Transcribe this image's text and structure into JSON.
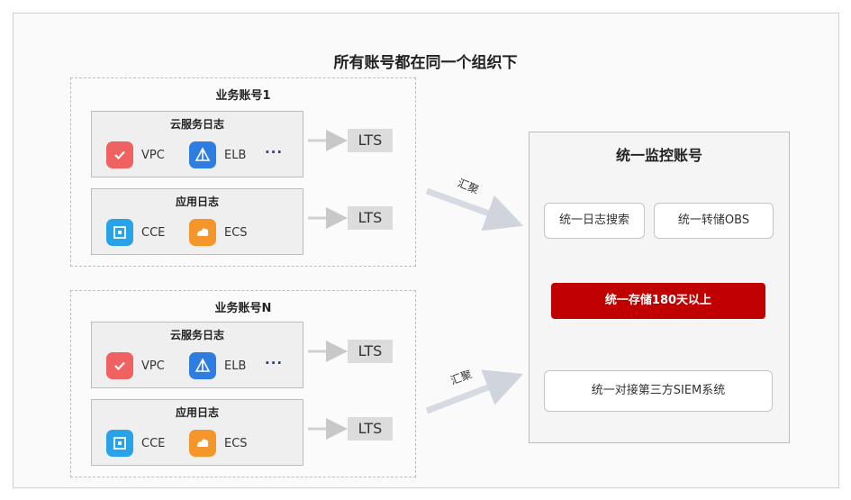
{
  "title": "所有账号都在同一个组织下",
  "accounts": [
    {
      "title": "业务账号1",
      "cloud_group": {
        "title": "云服务日志",
        "services": [
          "VPC",
          "ELB"
        ],
        "more": "···"
      },
      "app_group": {
        "title": "应用日志",
        "services": [
          "CCE",
          "ECS"
        ]
      },
      "lts": [
        "LTS",
        "LTS"
      ]
    },
    {
      "title": "业务账号N",
      "cloud_group": {
        "title": "云服务日志",
        "services": [
          "VPC",
          "ELB"
        ],
        "more": "···"
      },
      "app_group": {
        "title": "应用日志",
        "services": [
          "CCE",
          "ECS"
        ]
      },
      "lts": [
        "LTS",
        "LTS"
      ]
    }
  ],
  "aggregate_label": "汇聚",
  "monitor": {
    "title": "统一监控账号",
    "search": "统一日志搜索",
    "obs": "统一转储OBS",
    "storage": "统一存储180天以上",
    "siem": "统一对接第三方SIEM系统"
  },
  "colors": {
    "vpc": "#f06262",
    "elb": "#2f7de1",
    "cce": "#29a3e8",
    "ecs": "#f5962a",
    "red": "#c00000"
  },
  "icons": {
    "vpc": "vpc-icon",
    "elb": "elb-icon",
    "cce": "cce-icon",
    "ecs": "ecs-icon"
  }
}
